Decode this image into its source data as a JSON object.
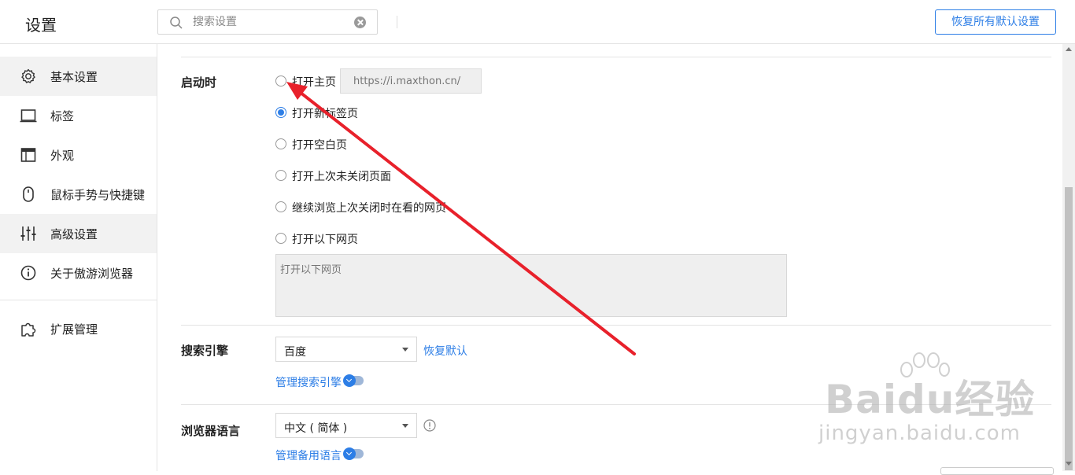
{
  "app": {
    "title": "设置"
  },
  "search": {
    "placeholder": "搜索设置"
  },
  "header": {
    "restore_all_label": "恢复所有默认设置"
  },
  "sidebar": {
    "items": [
      {
        "label": "基本设置",
        "icon": "gear-icon",
        "state": "active"
      },
      {
        "label": "标签",
        "icon": "tab-icon"
      },
      {
        "label": "外观",
        "icon": "window-icon"
      },
      {
        "label": "鼠标手势与快捷键",
        "icon": "mouse-icon"
      },
      {
        "label": "高级设置",
        "icon": "sliders-icon",
        "state": "hover"
      },
      {
        "label": "关于傲游浏览器",
        "icon": "info-icon"
      },
      {
        "label": "扩展管理",
        "icon": "puzzle-icon"
      }
    ]
  },
  "startup": {
    "title": "启动时",
    "homepage_url_placeholder": "https://i.maxthon.cn/",
    "options": [
      {
        "label": "打开主页",
        "checked": false
      },
      {
        "label": "打开新标签页",
        "checked": true
      },
      {
        "label": "打开空白页",
        "checked": false
      },
      {
        "label": "打开上次未关闭页面",
        "checked": false
      },
      {
        "label": "继续浏览上次关闭时在看的网页",
        "checked": false
      },
      {
        "label": "打开以下网页",
        "checked": false
      }
    ],
    "pages_placeholder": "打开以下网页"
  },
  "search_engine": {
    "title": "搜索引擎",
    "selected": "百度",
    "restore_default": "恢复默认",
    "manage_label": "管理搜索引擎"
  },
  "language": {
    "title": "浏览器语言",
    "selected": "中文 ( 简体 )",
    "manage_label": "管理备用语言"
  },
  "watermark": {
    "main": "Baidu经验",
    "sub": "jingyan.baidu.com"
  },
  "colors": {
    "accent": "#2d7ee6",
    "annotation_arrow": "#e8212b"
  }
}
